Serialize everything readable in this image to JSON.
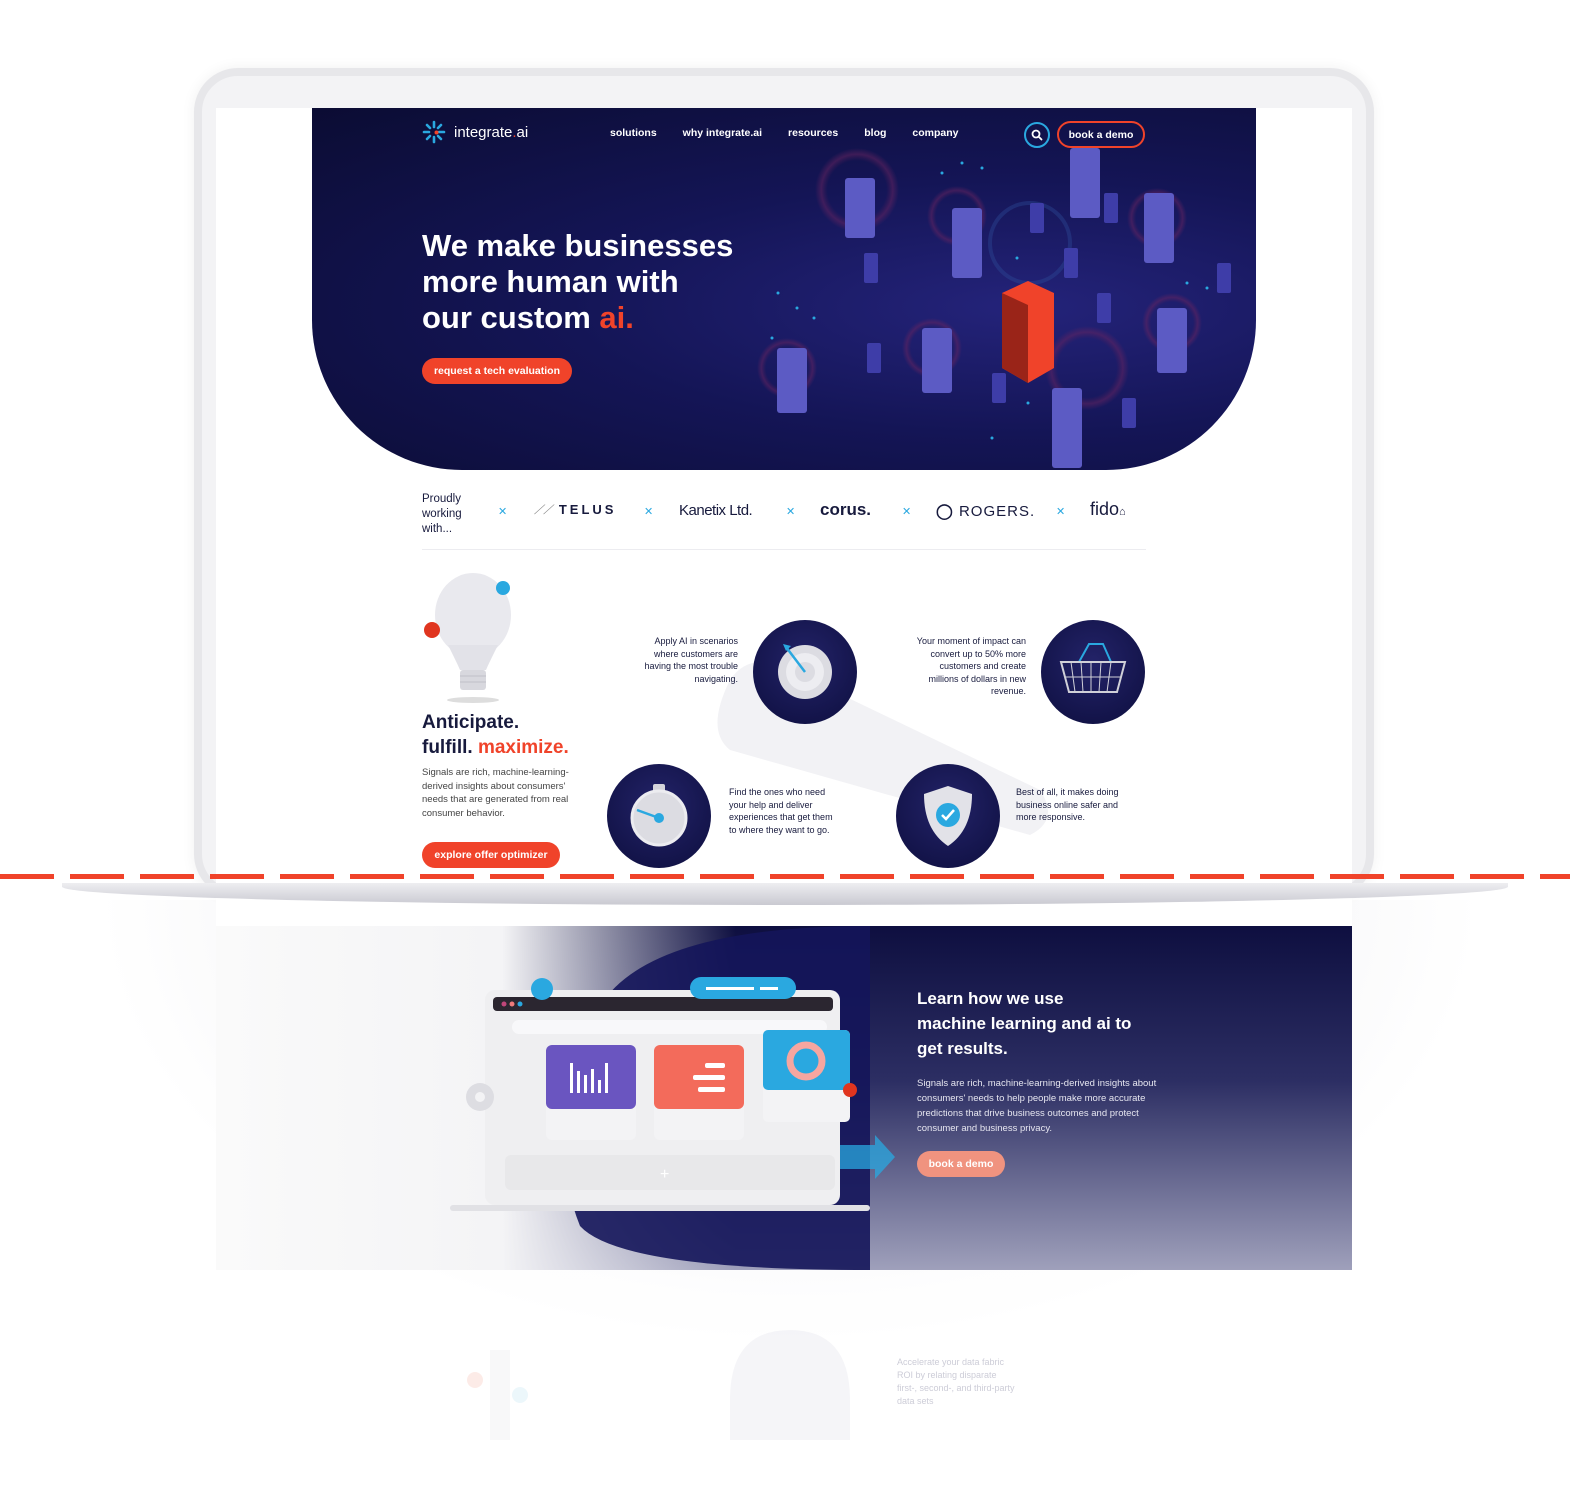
{
  "nav": {
    "logo_text": "integrate",
    "logo_dot": ".",
    "logo_suffix": "ai",
    "links": [
      "solutions",
      "why integrate.ai",
      "resources",
      "blog",
      "company"
    ],
    "search_icon": "search-icon",
    "demo_button": "book a demo"
  },
  "hero": {
    "title_line1": "We make businesses",
    "title_line2": "more human with",
    "title_line3": "our custom ",
    "title_accent": "ai.",
    "cta": "request a tech evaluation"
  },
  "partners": {
    "lead": "Proudly working with...",
    "logos": [
      "TELUS",
      "Kanetix Ltd.",
      "corus.",
      "ROGERS.",
      "fido"
    ]
  },
  "features": {
    "title_line1": "Anticipate.",
    "title_line2": "fulfill. ",
    "title_accent": "maximize.",
    "body": "Signals are rich, machine-learning-derived insights about consumers' needs that are generated from real consumer behavior.",
    "cta": "explore offer optimizer",
    "items": [
      {
        "icon": "target-icon",
        "text": "Apply AI in scenarios where customers are having the most trouble navigating."
      },
      {
        "icon": "basket-icon",
        "text": "Your moment of impact can convert up to 50% more customers and create millions of dollars in new revenue."
      },
      {
        "icon": "stopwatch-icon",
        "text": "Find the ones who need your help and deliver experiences that get them to where they want to go."
      },
      {
        "icon": "shield-check-icon",
        "text": "Best of all, it makes doing business online safer and more responsive."
      }
    ]
  },
  "learn": {
    "title": "Learn how we use machine learning and ai to get results.",
    "body": "Signals are rich, machine-learning-derived insights about consumers' needs to help people make more accurate predictions that drive business outcomes and protect consumer and business privacy.",
    "cta": "book a demo"
  },
  "reflection": {
    "text": "Accelerate your data fabric ROI by relating disparate first-, second-, and third-party data sets"
  },
  "colors": {
    "navy": "#0b0c33",
    "accent": "#f0432a",
    "blue": "#2aa8e0"
  }
}
